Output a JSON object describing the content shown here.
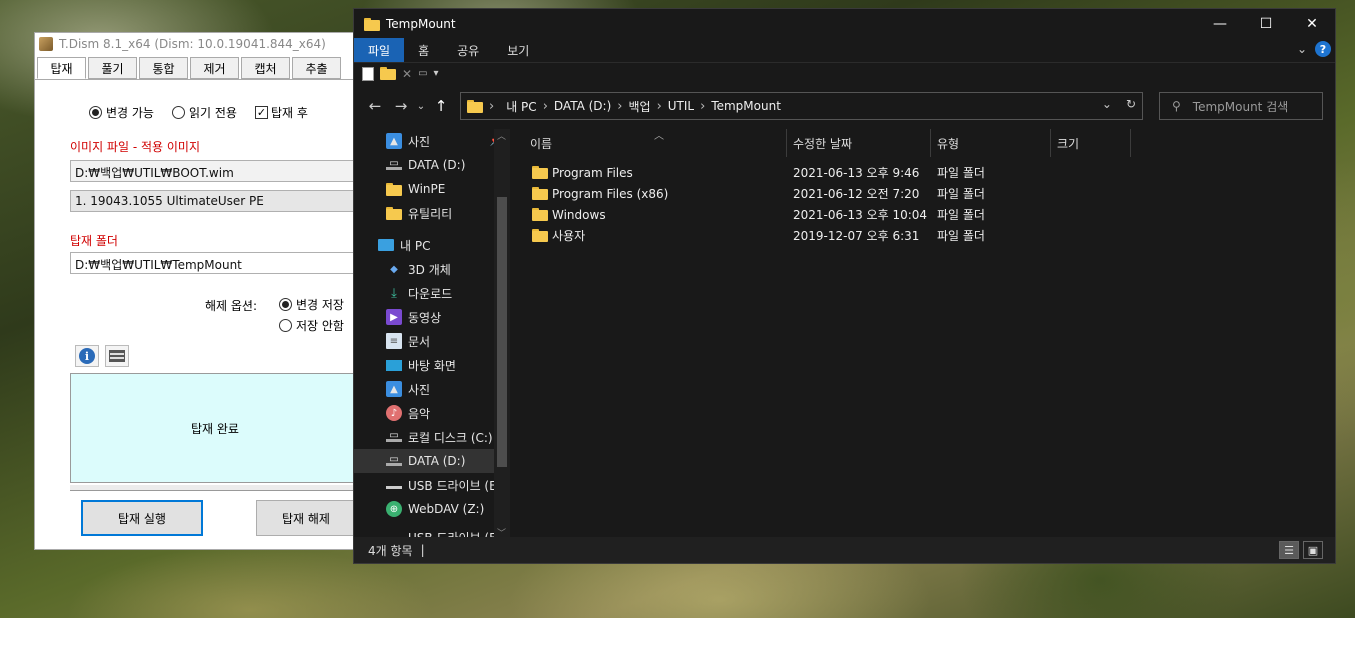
{
  "tdism": {
    "title": "T.Dism 8.1_x64   (Dism: 10.0.19041.844_x64)",
    "tabs": [
      "탑재",
      "풀기",
      "통합",
      "제거",
      "캡처",
      "추출"
    ],
    "radio_rw": "변경 가능",
    "radio_ro": "읽기 전용",
    "check_label": "탑재 후",
    "image_label": "이미지 파일 - 적용 이미지",
    "image_path": "D:₩백업₩UTIL₩BOOT.wim",
    "image_index": "1. 19043.1055 UltimateUser PE",
    "mount_label": "탑재 폴더",
    "mount_path": "D:₩백업₩UTIL₩TempMount",
    "unmount_label": "해제 옵션:",
    "opt_save": "변경 저장",
    "opt_nosave": "저장 안함",
    "status": "탑재 완료",
    "btn_mount": "탑재 실행",
    "btn_unmount": "탑재 해제"
  },
  "explorer": {
    "title": "TempMount",
    "window_buttons": [
      "—",
      "☐",
      "✕"
    ],
    "ribbon_tabs": [
      "파일",
      "홈",
      "공유",
      "보기"
    ],
    "breadcrumb": [
      "내 PC",
      "DATA (D:)",
      "백업",
      "UTIL",
      "TempMount"
    ],
    "search_placeholder": "TempMount 검색",
    "nav": [
      {
        "label": "사진",
        "icon": "photos-icon",
        "pinned": true
      },
      {
        "label": "DATA (D:)",
        "icon": "drive-icon"
      },
      {
        "label": "WinPE",
        "icon": "folder-icon"
      },
      {
        "label": "유틸리티",
        "icon": "folder-icon"
      },
      {
        "label": "내 PC",
        "icon": "pc-icon"
      },
      {
        "label": "3D 개체",
        "icon": "3d-objects-icon"
      },
      {
        "label": "다운로드",
        "icon": "download-icon"
      },
      {
        "label": "동영상",
        "icon": "videos-icon"
      },
      {
        "label": "문서",
        "icon": "documents-icon"
      },
      {
        "label": "바탕 화면",
        "icon": "desktop-icon"
      },
      {
        "label": "사진",
        "icon": "photos-icon"
      },
      {
        "label": "음악",
        "icon": "music-icon"
      },
      {
        "label": "로컬 디스크 (C:)",
        "icon": "drive-icon"
      },
      {
        "label": "DATA (D:)",
        "icon": "drive-icon"
      },
      {
        "label": "USB 드라이브 (E",
        "icon": "usb-icon"
      },
      {
        "label": "WebDAV (Z:)",
        "icon": "network-drive-icon"
      },
      {
        "label": "USB 드라이브 (E:)",
        "icon": "usb-icon"
      }
    ],
    "columns": [
      "이름",
      "수정한 날짜",
      "유형",
      "크기"
    ],
    "files": [
      {
        "name": "Program Files",
        "date": "2021-06-13 오후 9:46",
        "type": "파일 폴더"
      },
      {
        "name": "Program Files (x86)",
        "date": "2021-06-12 오전 7:20",
        "type": "파일 폴더"
      },
      {
        "name": "Windows",
        "date": "2021-06-13 오후 10:04",
        "type": "파일 폴더"
      },
      {
        "name": "사용자",
        "date": "2019-12-07 오후 6:31",
        "type": "파일 폴더"
      }
    ],
    "status": "4개 항목"
  }
}
